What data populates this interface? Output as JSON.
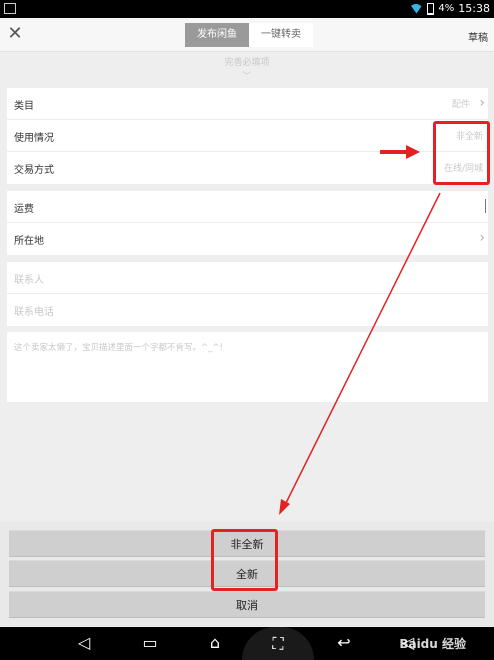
{
  "status_bar": {
    "battery_percent": "4%",
    "time": "15:38"
  },
  "topbar": {
    "close_icon": "close-icon",
    "tabs": [
      {
        "label": "发布闲鱼",
        "active": true
      },
      {
        "label": "一键转卖",
        "active": false
      }
    ],
    "draft_label": "草稿"
  },
  "hint_text": "完善必填项",
  "form": {
    "group1": [
      {
        "label": "类目",
        "value": "配件",
        "has_arrow": true
      },
      {
        "label": "使用情况",
        "value": "非全新"
      },
      {
        "label": "交易方式",
        "value": "在线/同城"
      }
    ],
    "group2": [
      {
        "label": "运费"
      },
      {
        "label": "所在地",
        "has_arrow": true
      }
    ],
    "group3": [
      {
        "placeholder": "联系人"
      },
      {
        "placeholder": "联系电话"
      }
    ],
    "description_placeholder": "这个卖家太懒了，宝贝描述里面一个字都不肯写。^_^!"
  },
  "action_sheet": {
    "options": [
      "非全新",
      "全新"
    ],
    "cancel": "取消"
  },
  "nav_bar": {
    "icons": [
      "volume-down-icon",
      "recents-icon",
      "home-icon",
      "screenshot-icon",
      "back-icon",
      "volume-up-icon"
    ],
    "watermark": "Baidu 经验"
  },
  "colors": {
    "highlight": "#e32222",
    "tab_active": "#9a9a9a",
    "placeholder": "#c8c8c8"
  }
}
